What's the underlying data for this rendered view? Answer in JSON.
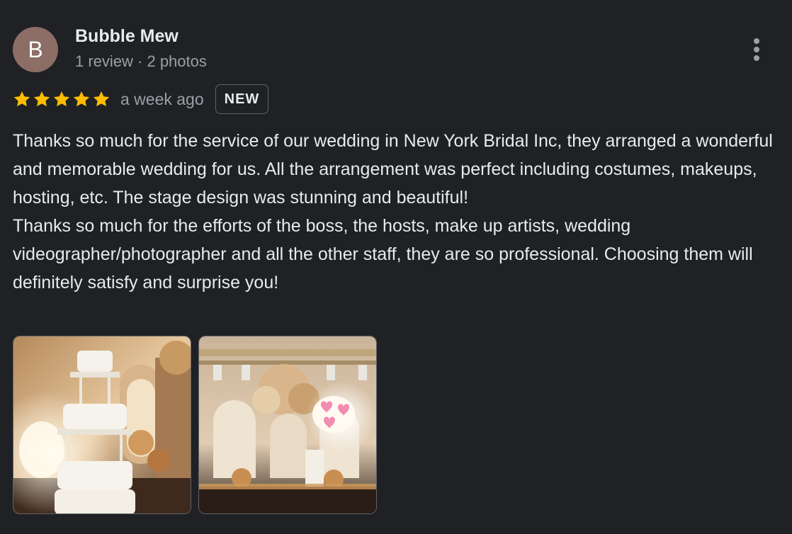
{
  "reviewer": {
    "initial": "B",
    "name": "Bubble Mew",
    "meta": "1 review · 2 photos",
    "avatar_color": "#8c6e66"
  },
  "actions": {
    "more_icon": "more-vertical-icon"
  },
  "rating": {
    "stars": 5,
    "star_color": "#fbbc04",
    "date": "a week ago",
    "badge": "NEW"
  },
  "review": {
    "paragraphs": [
      "Thanks so much for the service of our wedding in New York Bridal Inc, they arranged a wonderful and memorable wedding for us. All the arrangement was perfect including costumes, makeups, hosting, etc. The stage design was stunning and beautiful!",
      "Thanks so much for the efforts of the boss, the hosts, make up artists, wedding videographer/photographer and all the other staff, they are so professional. Choosing them will definitely satisfy and surprise you!"
    ]
  },
  "photos": [
    {
      "name": "wedding-cake-photo"
    },
    {
      "name": "wedding-stage-photo"
    }
  ],
  "colors": {
    "background": "#202124",
    "text_primary": "#e8eaed",
    "text_secondary": "#9aa0a6",
    "border": "#5f6368"
  }
}
